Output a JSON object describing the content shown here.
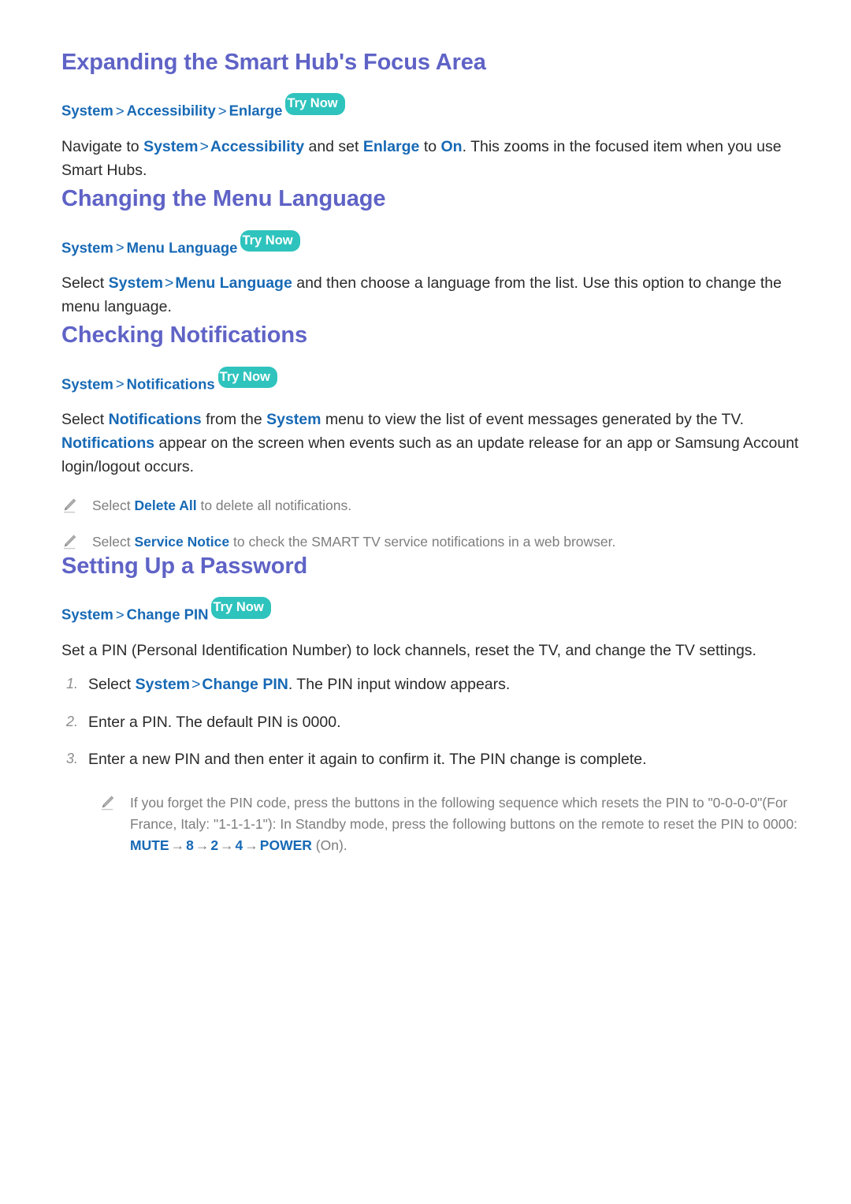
{
  "sections": [
    {
      "id": "enlarge",
      "title": "Expanding the Smart Hub's Focus Area",
      "path": {
        "items": [
          "System",
          "Accessibility",
          "Enlarge"
        ],
        "separator": ">",
        "badge": "Try Now"
      },
      "paragraph": {
        "p1": "Navigate to ",
        "l1": "System",
        "s1": ">",
        "l2": "Accessibility",
        "p2": " and set ",
        "l3": "Enlarge",
        "p3": " to ",
        "l4": "On",
        "p4": ". This zooms in the focused item when you use Smart Hubs."
      }
    },
    {
      "id": "menu-language",
      "title": "Changing the Menu Language",
      "path": {
        "items": [
          "System",
          "Menu Language"
        ],
        "separator": ">",
        "badge": "Try Now"
      },
      "paragraph": {
        "p1": "Select ",
        "l1": "System",
        "s1": ">",
        "l2": "Menu Language",
        "p2": " and then choose a language from the list. Use this option to change the menu language."
      }
    },
    {
      "id": "notifications",
      "title": "Checking Notifications",
      "path": {
        "items": [
          "System",
          "Notifications"
        ],
        "separator": ">",
        "badge": "Try Now"
      },
      "paragraph": {
        "p1": "Select ",
        "l1": "Notifications",
        "p2": " from the ",
        "l2": "System",
        "p3": " menu to view the list of event messages generated by the TV. ",
        "l3": "Notifications",
        "p4": " appear on the screen when events such as an update release for an app or Samsung Account login/logout occurs."
      },
      "notes": [
        {
          "icon": "pencil-icon",
          "p1": "Select ",
          "l1": "Delete All",
          "p2": " to delete all notifications."
        },
        {
          "icon": "pencil-icon",
          "p1": "Select ",
          "l1": "Service Notice",
          "p2": " to check the SMART TV service notifications in a web browser."
        }
      ]
    },
    {
      "id": "password",
      "title": "Setting Up a Password",
      "path": {
        "items": [
          "System",
          "Change PIN"
        ],
        "separator": ">",
        "badge": "Try Now"
      },
      "paragraph": {
        "p1": "Set a PIN (Personal Identification Number) to lock channels, reset the TV, and change the TV settings."
      },
      "steps": [
        {
          "num": "1.",
          "p1": "Select ",
          "l1": "System",
          "s1": ">",
          "l2": "Change PIN",
          "p2": ". The PIN input window appears."
        },
        {
          "num": "2.",
          "p1": "Enter a PIN. The default PIN is 0000."
        },
        {
          "num": "3.",
          "p1": "Enter a new PIN and then enter it again to confirm it. The PIN change is complete."
        }
      ],
      "final_note": {
        "icon": "pencil-icon",
        "p1": "If you forget the PIN code, press the buttons in the following sequence which resets the PIN to \"0-0-0-0\"(For France, Italy: \"1-1-1-1\"): In Standby mode, press the following buttons on the remote to reset the PIN to 0000: ",
        "k1": "MUTE",
        "a1": "→",
        "k2": "8",
        "a2": "→",
        "k3": "2",
        "a3": "→",
        "k4": "4",
        "a4": "→",
        "k5": "POWER",
        "p2": " (On)."
      }
    }
  ],
  "colors": {
    "heading": "#5f63c6",
    "link": "#1769b5",
    "badge_bg": "#2fc3bd",
    "badge_text": "#ffffff",
    "body_text": "#2a2a2a",
    "note_text": "#7d7d7d",
    "step_number": "#8d8d8d",
    "page_bg": "#ffffff"
  }
}
